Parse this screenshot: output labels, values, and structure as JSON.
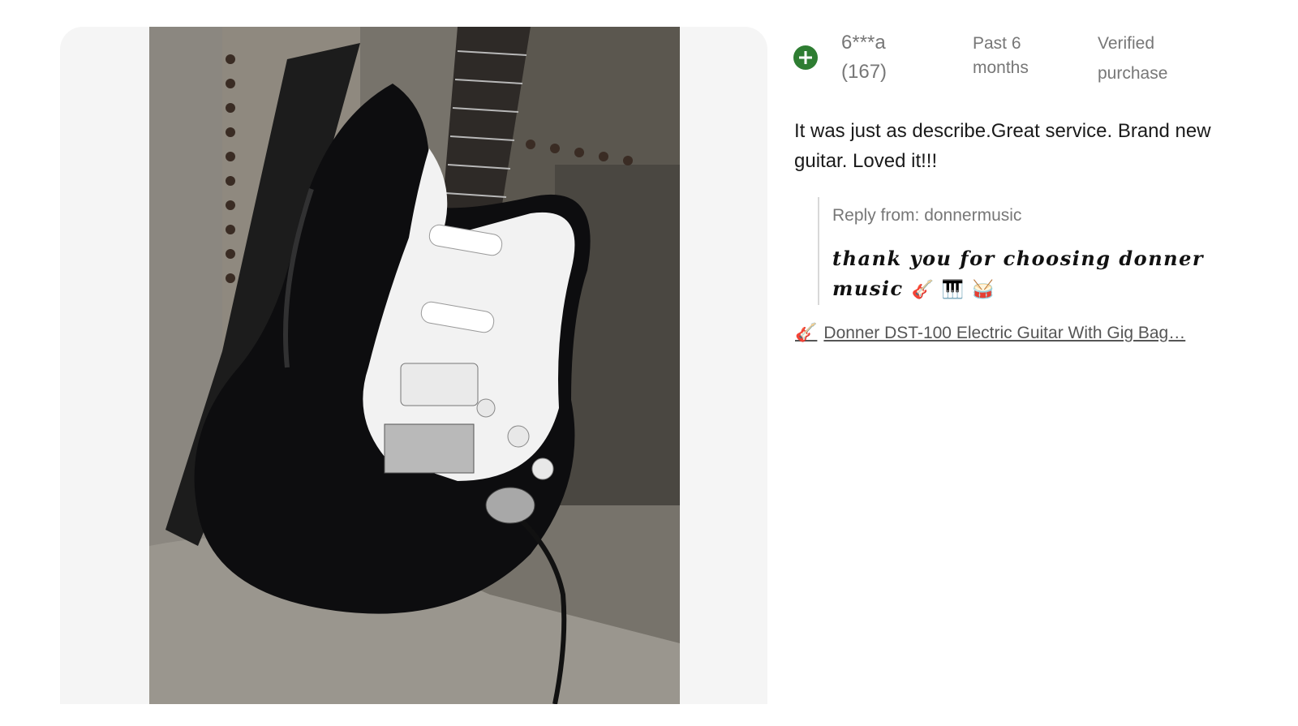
{
  "review": {
    "user": "6***a",
    "review_count": "(167)",
    "date": "Past 6 months",
    "verified": "Verified purchase",
    "text": "It was just as describe.Great service. Brand new guitar. Loved it!!!"
  },
  "reply": {
    "label": "Reply from: donnermusic",
    "text": "thank you for choosing donner music",
    "emojis": [
      "🎸",
      "🎹",
      "🥁"
    ]
  },
  "product": {
    "emoji": "🎸",
    "link_text": "Donner DST-100 Electric Guitar With Gig Bag…"
  },
  "icons": {
    "add": "plus-circle-icon"
  },
  "colors": {
    "accent_green": "#2e7d32",
    "meta_gray": "#777777",
    "panel_bg": "#f5f5f5"
  }
}
